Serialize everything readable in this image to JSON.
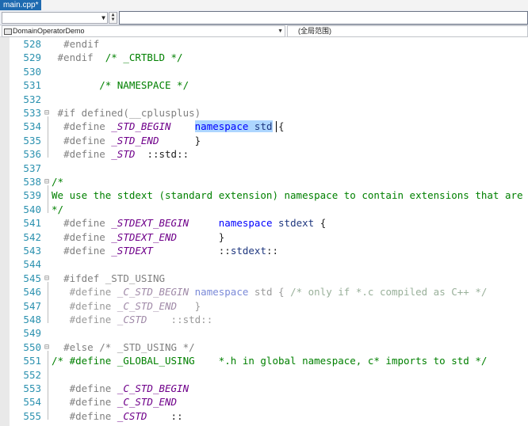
{
  "tab": {
    "title": "main.cpp*"
  },
  "toolbar": {
    "combo1_value": "",
    "combo2_value": ""
  },
  "navbar": {
    "left_label": "DomainOperatorDemo",
    "right_label": "(全局范围)"
  },
  "editor": {
    "lines": [
      {
        "num": "528",
        "fold": "",
        "tokens": [
          {
            "t": "  ",
            "c": ""
          },
          {
            "t": "#endif",
            "c": "pp"
          }
        ]
      },
      {
        "num": "529",
        "fold": "",
        "tokens": [
          {
            "t": " ",
            "c": ""
          },
          {
            "t": "#endif",
            "c": "pp"
          },
          {
            "t": "  /* _CRTBLD */",
            "c": "cm"
          }
        ]
      },
      {
        "num": "530",
        "fold": "",
        "tokens": []
      },
      {
        "num": "531",
        "fold": "",
        "tokens": [
          {
            "t": "        /* NAMESPACE */",
            "c": "cm"
          }
        ]
      },
      {
        "num": "532",
        "fold": "",
        "tokens": []
      },
      {
        "num": "533",
        "fold": "⊟",
        "tokens": [
          {
            "t": " ",
            "c": ""
          },
          {
            "t": "#if defined(__cplusplus)",
            "c": "pp"
          }
        ]
      },
      {
        "num": "534",
        "fold": "",
        "tokens": [
          {
            "t": "  ",
            "c": ""
          },
          {
            "t": "#define ",
            "c": "pp"
          },
          {
            "t": "_STD_BEGIN",
            "c": "mac"
          },
          {
            "t": "    ",
            "c": ""
          },
          {
            "t": "namespace",
            "c": "kw hl"
          },
          {
            "t": " ",
            "c": "hl"
          },
          {
            "t": "std",
            "c": "ns hl"
          },
          {
            "t": " {",
            "c": ""
          }
        ]
      },
      {
        "num": "535",
        "fold": "",
        "tokens": [
          {
            "t": "  ",
            "c": ""
          },
          {
            "t": "#define ",
            "c": "pp"
          },
          {
            "t": "_STD_END",
            "c": "mac"
          },
          {
            "t": "      }",
            "c": ""
          }
        ]
      },
      {
        "num": "536",
        "fold": "",
        "tokens": [
          {
            "t": "  ",
            "c": ""
          },
          {
            "t": "#define ",
            "c": "pp"
          },
          {
            "t": "_STD",
            "c": "mac"
          },
          {
            "t": "  ::std::",
            "c": ""
          }
        ]
      },
      {
        "num": "537",
        "fold": "",
        "tokens": []
      },
      {
        "num": "538",
        "fold": "⊟",
        "tokens": [
          {
            "t": "/*",
            "c": "cm"
          }
        ]
      },
      {
        "num": "539",
        "fold": "",
        "tokens": [
          {
            "t": "We use the stdext (standard extension) namespace to contain extensions that are",
            "c": "cm"
          }
        ]
      },
      {
        "num": "540",
        "fold": "",
        "tokens": [
          {
            "t": "*/",
            "c": "cm"
          }
        ]
      },
      {
        "num": "541",
        "fold": "",
        "tokens": [
          {
            "t": "  ",
            "c": ""
          },
          {
            "t": "#define ",
            "c": "pp"
          },
          {
            "t": "_STDEXT_BEGIN",
            "c": "mac"
          },
          {
            "t": "     ",
            "c": ""
          },
          {
            "t": "namespace",
            "c": "kw"
          },
          {
            "t": " ",
            "c": ""
          },
          {
            "t": "stdext",
            "c": "ns"
          },
          {
            "t": " {",
            "c": ""
          }
        ]
      },
      {
        "num": "542",
        "fold": "",
        "tokens": [
          {
            "t": "  ",
            "c": ""
          },
          {
            "t": "#define ",
            "c": "pp"
          },
          {
            "t": "_STDEXT_END",
            "c": "mac"
          },
          {
            "t": "       }",
            "c": ""
          }
        ]
      },
      {
        "num": "543",
        "fold": "",
        "tokens": [
          {
            "t": "  ",
            "c": ""
          },
          {
            "t": "#define ",
            "c": "pp"
          },
          {
            "t": "_STDEXT",
            "c": "mac"
          },
          {
            "t": "           ::",
            "c": ""
          },
          {
            "t": "stdext",
            "c": "ns"
          },
          {
            "t": "::",
            "c": ""
          }
        ]
      },
      {
        "num": "544",
        "fold": "",
        "tokens": []
      },
      {
        "num": "545",
        "fold": "⊟",
        "tokens": [
          {
            "t": "  ",
            "c": ""
          },
          {
            "t": "#ifdef _STD_USING",
            "c": "pp"
          }
        ]
      },
      {
        "num": "546",
        "fold": "",
        "tokens": [
          {
            "t": "   ",
            "c": ""
          },
          {
            "t": "#define ",
            "c": "dim"
          },
          {
            "t": "_C_STD_BEGIN",
            "c": "dim-mac"
          },
          {
            "t": " ",
            "c": ""
          },
          {
            "t": "namespace",
            "c": "dim-kw"
          },
          {
            "t": " std { ",
            "c": "dim"
          },
          {
            "t": "/* only if *.c compiled as C++ */",
            "c": "dim-cm"
          }
        ]
      },
      {
        "num": "547",
        "fold": "",
        "tokens": [
          {
            "t": "   ",
            "c": ""
          },
          {
            "t": "#define ",
            "c": "dim"
          },
          {
            "t": "_C_STD_END",
            "c": "dim-mac"
          },
          {
            "t": "   }",
            "c": "dim"
          }
        ]
      },
      {
        "num": "548",
        "fold": "",
        "tokens": [
          {
            "t": "   ",
            "c": ""
          },
          {
            "t": "#define ",
            "c": "dim"
          },
          {
            "t": "_CSTD",
            "c": "dim-mac"
          },
          {
            "t": "    ::std::",
            "c": "dim"
          }
        ]
      },
      {
        "num": "549",
        "fold": "",
        "tokens": []
      },
      {
        "num": "550",
        "fold": "⊟",
        "tokens": [
          {
            "t": "  ",
            "c": ""
          },
          {
            "t": "#else",
            "c": "pp"
          },
          {
            "t": " /* _STD_USING */",
            "c": "pp"
          }
        ]
      },
      {
        "num": "551",
        "fold": "",
        "tokens": [
          {
            "t": "/* #define _GLOBAL_USING    *.h in global namespace, c* imports to std */",
            "c": "cm"
          }
        ]
      },
      {
        "num": "552",
        "fold": "",
        "tokens": []
      },
      {
        "num": "553",
        "fold": "",
        "tokens": [
          {
            "t": "   ",
            "c": ""
          },
          {
            "t": "#define ",
            "c": "pp"
          },
          {
            "t": "_C_STD_BEGIN",
            "c": "mac"
          }
        ]
      },
      {
        "num": "554",
        "fold": "",
        "tokens": [
          {
            "t": "   ",
            "c": ""
          },
          {
            "t": "#define ",
            "c": "pp"
          },
          {
            "t": "_C_STD_END",
            "c": "mac"
          }
        ]
      },
      {
        "num": "555",
        "fold": "",
        "tokens": [
          {
            "t": "   ",
            "c": ""
          },
          {
            "t": "#define ",
            "c": "pp"
          },
          {
            "t": "_CSTD",
            "c": "mac"
          },
          {
            "t": "    ::",
            "c": ""
          }
        ]
      }
    ]
  }
}
